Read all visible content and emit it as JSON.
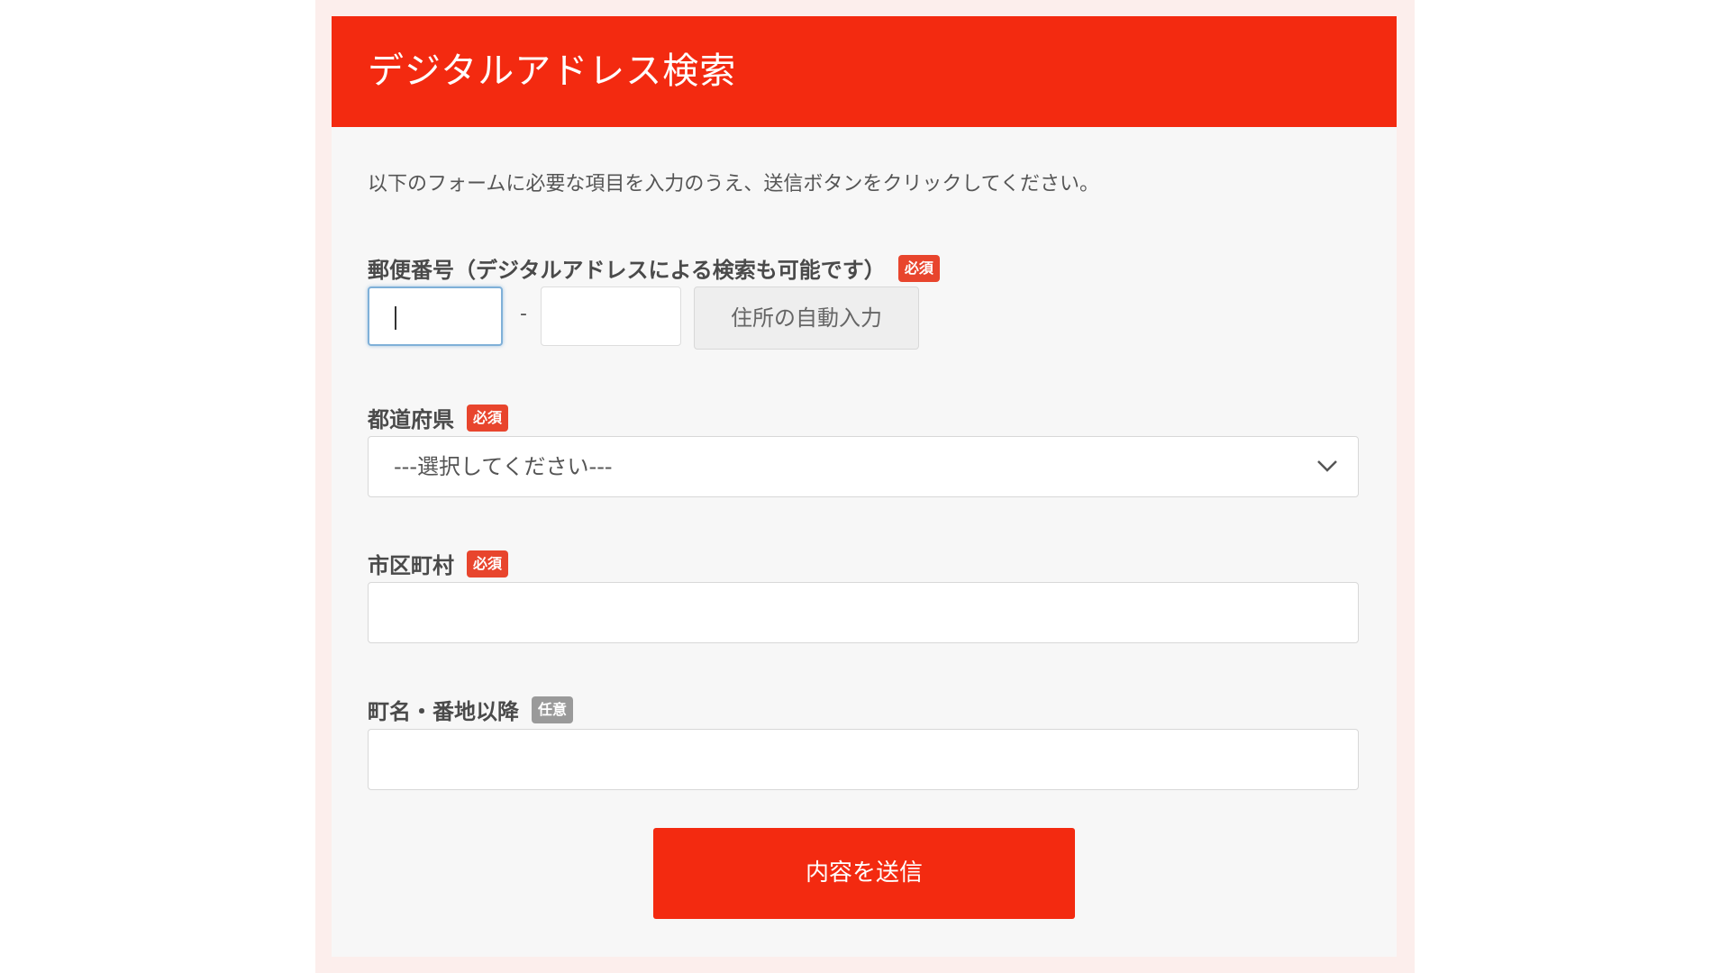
{
  "header": {
    "title": "デジタルアドレス検索"
  },
  "intro": "以下のフォームに必要な項目を入力のうえ、送信ボタンをクリックしてください。",
  "badges": {
    "required": "必須",
    "optional": "任意"
  },
  "postal": {
    "label": "郵便番号（デジタルアドレスによる検索も可能です）",
    "first_value": "",
    "second_value": "",
    "separator": "-",
    "auto_fill_label": "住所の自動入力"
  },
  "prefecture": {
    "label": "都道府県",
    "selected": "---選択してください---"
  },
  "city": {
    "label": "市区町村",
    "value": ""
  },
  "street": {
    "label": "町名・番地以降",
    "value": ""
  },
  "submit": {
    "label": "内容を送信"
  },
  "colors": {
    "accent": "#f32a10",
    "required_badge": "#e8452d",
    "optional_badge": "#9a9a9a"
  },
  "icons": {
    "select_arrow": "chevron-down-icon"
  }
}
